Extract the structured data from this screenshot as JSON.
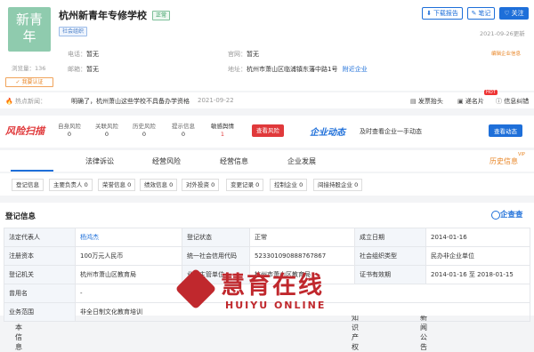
{
  "company": {
    "logo_line1": "新青",
    "logo_line2": "年",
    "name": "杭州新青年专修学校",
    "status": "正常",
    "tag": "社会组织",
    "views_label": "浏览量：136",
    "claim_label": "我要认证",
    "updated": "2021-09-26更新",
    "phone_label": "电话：",
    "phone_value": "暂无",
    "website_label": "官网：",
    "website_value": "暂无",
    "email_label": "邮箱：",
    "email_value": "暂无",
    "address_label": "地址：",
    "address_value": "杭州市萧山区临浦镇东藩中路1号",
    "nearby": "附近企业",
    "edit_label": "编辑企业信息"
  },
  "actions": {
    "download": "下载报告",
    "note": "笔记",
    "follow": "关注"
  },
  "hot": {
    "label": "热点新闻：",
    "text": "明确了，杭州萧山这些学校不具备办学资格",
    "date": "2021-09-22",
    "invoice": "发票抬头",
    "cards": "递名片",
    "hot_badge": "HOT",
    "error": "信息纠错"
  },
  "risk": {
    "logo": "风险扫描",
    "items": [
      {
        "label": "自身风险",
        "value": "0"
      },
      {
        "label": "关联风险",
        "value": "0"
      },
      {
        "label": "历史风险",
        "value": "0"
      },
      {
        "label": "提示信息",
        "value": "0"
      },
      {
        "label": "敏感舆情",
        "value": "1"
      }
    ],
    "check_button": "查看风险",
    "news_logo": "企业动态",
    "news_text": "及时查看企业一手动态",
    "news_button": "查看动态"
  },
  "tabs": [
    {
      "label": "基本信息",
      "count": "1"
    },
    {
      "label": "法律诉讼",
      "count": ""
    },
    {
      "label": "经营风险",
      "count": ""
    },
    {
      "label": "经营信息",
      "count": ""
    },
    {
      "label": "企业发展",
      "count": ""
    },
    {
      "label": "知识产权",
      "count": "1"
    },
    {
      "label": "新闻公告",
      "count": "1"
    },
    {
      "label": "历史信息",
      "count": ""
    }
  ],
  "vip_badge": "VIP",
  "subtabs": [
    "登记信息",
    "主要负责人 0",
    "荣誉信息 0",
    "绩效信息 0",
    "对外投资 0",
    "变更记录 0",
    "控制企业 0",
    "间接持股企业 0"
  ],
  "section": {
    "title": "登记信息",
    "brand": "企查查"
  },
  "table": {
    "rows": [
      [
        "法定代表人",
        "杨鸿杰",
        "登记状态",
        "正常",
        "成立日期",
        "2014-01-16"
      ],
      [
        "注册资本",
        "100万元人民币",
        "统一社会信用代码",
        "523301090888767867",
        "社会组织类型",
        "民办非企业单位"
      ],
      [
        "登记机关",
        "杭州市萧山区教育局",
        "业务主管单位",
        "杭州市萧山区教育局",
        "证书有效期",
        "2014-01-16 至 2018-01-15"
      ],
      [
        "曾用名",
        "-",
        "",
        "",
        "",
        ""
      ],
      [
        "业务范围",
        "非全日制文化教育培训",
        "",
        "",
        "",
        ""
      ]
    ]
  },
  "watermark": {
    "cn": "慧育在线",
    "en": "HUIYU ONLINE",
    "color": "#c0282d"
  }
}
